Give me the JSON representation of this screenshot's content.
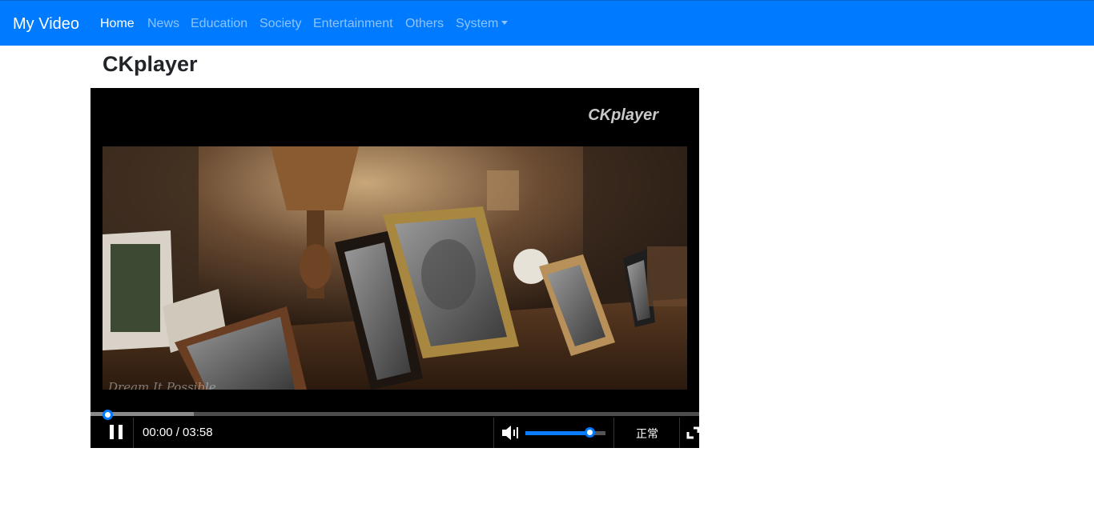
{
  "navbar": {
    "brand": "My Video",
    "links": [
      {
        "label": "Home",
        "active": true
      },
      {
        "label": "News"
      },
      {
        "label": "Education"
      },
      {
        "label": "Society"
      },
      {
        "label": "Entertainment"
      },
      {
        "label": "Others"
      },
      {
        "label": "System",
        "dropdown": true
      }
    ],
    "background_color": "#007bff"
  },
  "page": {
    "title": "CKplayer"
  },
  "player": {
    "logo_text": "CKplayer",
    "video_watermark": "Dream It Possible",
    "current_time": "00:00",
    "time_separator": " / ",
    "duration": "03:58",
    "time_display": "00:00 / 03:58",
    "playing": true,
    "progress_fraction": 0.0,
    "buffered_fraction": 0.17,
    "volume_fraction": 0.8,
    "speed_label": "正常",
    "accent_color": "#0078ff",
    "icons": {
      "pause": "pause-icon",
      "volume": "volume-icon",
      "fullscreen": "fullscreen-icon"
    }
  }
}
